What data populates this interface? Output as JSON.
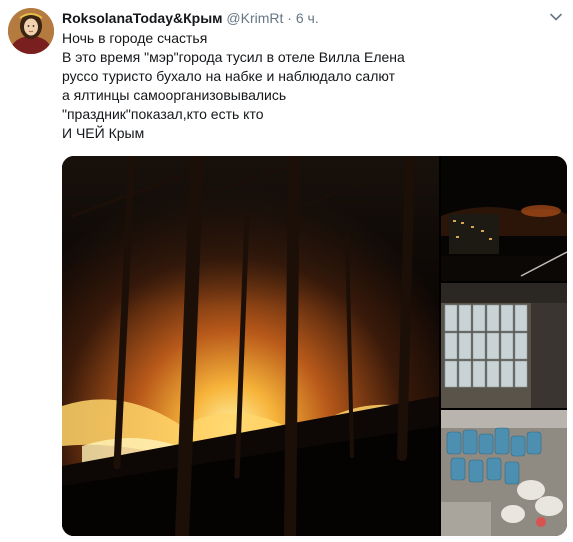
{
  "tweet": {
    "author_name": "RoksolanaToday&Крым",
    "handle": "@KrimRt",
    "separator": "·",
    "time": "6 ч.",
    "lines": [
      "Ночь в городе счастья",
      "В это время \"мэр\"города тусил в отеле Вилла Елена",
      "руссо туристо бухало на набке и наблюдало салют",
      "а ялтинцы самоорганизовывались",
      "\"праздник\"показал,кто есть кто",
      "И ЧЕЙ Крым"
    ]
  },
  "icons": {
    "avatar": "avatar-portrait",
    "menu": "chevron-down-icon"
  },
  "colors": {
    "name": "#14171a",
    "secondary": "#657786",
    "fire": "#f5a623"
  }
}
